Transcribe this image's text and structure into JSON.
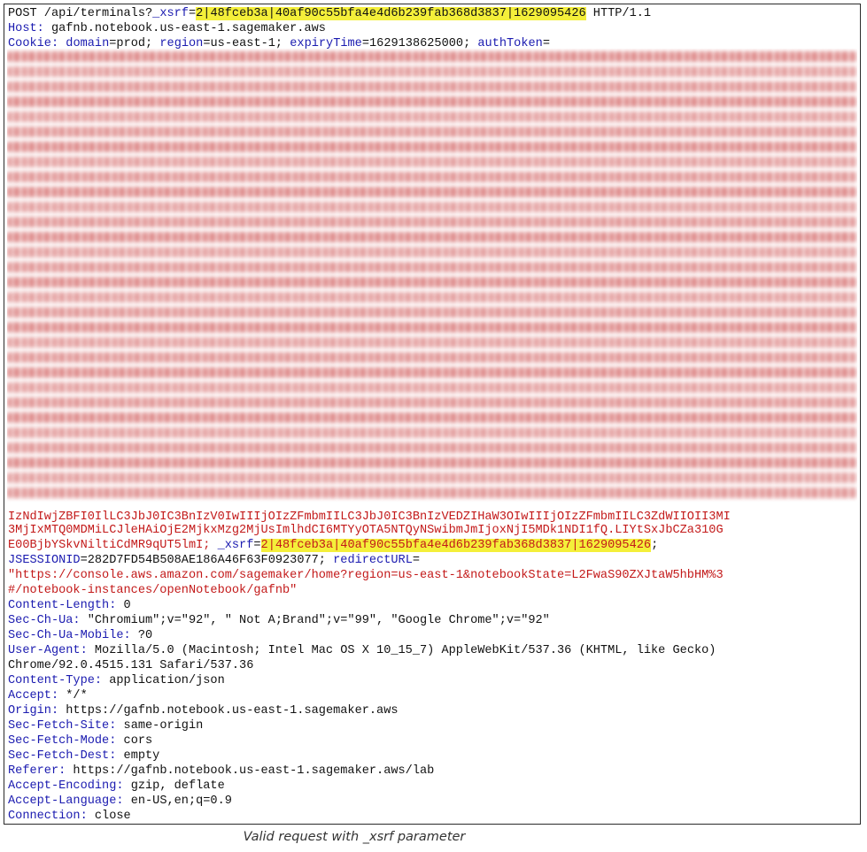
{
  "request": {
    "line1": {
      "prefix": "POST /api/terminals?",
      "param_name": "_xsrf",
      "eq": "=",
      "value": "2|48fceb3a|40af90c55bfa4e4d6b239fab368d3837|1629095426",
      "suffix": " HTTP/1.1"
    },
    "host": {
      "name": "Host:",
      "value": " gafnb.notebook.us-east-1.sagemaker.aws"
    },
    "cookie": {
      "name": "Cookie:",
      "domain_key": "domain",
      "domain_val": "prod",
      "region_key": "region",
      "region_val": "us-east-1",
      "expiry_key": "expiryTime",
      "expiry_val": "1629138625000",
      "auth_key": "authToken"
    },
    "cookie_tail": {
      "line_partial": "IzNdIwjZBFI0IlLC3JbJ0IC3BnIzV0IwIIIjOIzZFmbmIILC3JbJ0IC3BnIzVEDZIHaW3OIwIIIjOIzZFmbmIILC3ZdWIIOII3MI",
      "line_a": "3MjIxMTQ0MDMiLCJleHAiOjE2MjkxMzg2MjUsImlhdCI6MTYyOTA5NTQyNSwibmJmIjoxNjI5MDk1NDI1fQ.LIYtSxJbCZa310G",
      "line_b_start": "E00BjbYSkvNiltiCdMR9qUT5lmI; ",
      "xsrf_key": "_xsrf",
      "xsrf_value": "2|48fceb3a|40af90c55bfa4e4d6b239fab368d3837|1629095426",
      "semicolon": ";",
      "jsession_key": "JSESSIONID",
      "jsession_val": "282D7FD54B508AE186A46F63F0923077",
      "redirect_key": "redirectURL",
      "redirect_val_1": "\"https://console.aws.amazon.com/sagemaker/home?region=us-east-1&notebookState=L2FwaS90ZXJtaW5hbHM%3",
      "redirect_val_2": "#/notebook-instances/openNotebook/gafnb\""
    },
    "headers": [
      {
        "name": "Content-Length:",
        "value": " 0"
      },
      {
        "name": "Sec-Ch-Ua:",
        "value": " \"Chromium\";v=\"92\", \" Not A;Brand\";v=\"99\", \"Google Chrome\";v=\"92\""
      },
      {
        "name": "Sec-Ch-Ua-Mobile:",
        "value": " ?0"
      },
      {
        "name": "User-Agent:",
        "value": " Mozilla/5.0 (Macintosh; Intel Mac OS X 10_15_7) AppleWebKit/537.36 (KHTML, like Gecko)"
      },
      {
        "name": "",
        "value": "Chrome/92.0.4515.131 Safari/537.36"
      },
      {
        "name": "Content-Type:",
        "value": " application/json"
      },
      {
        "name": "Accept:",
        "value": " */*"
      },
      {
        "name": "Origin:",
        "value": " https://gafnb.notebook.us-east-1.sagemaker.aws"
      },
      {
        "name": "Sec-Fetch-Site:",
        "value": " same-origin"
      },
      {
        "name": "Sec-Fetch-Mode:",
        "value": " cors"
      },
      {
        "name": "Sec-Fetch-Dest:",
        "value": " empty"
      },
      {
        "name": "Referer:",
        "value": " https://gafnb.notebook.us-east-1.sagemaker.aws/lab"
      },
      {
        "name": "Accept-Encoding:",
        "value": " gzip, deflate"
      },
      {
        "name": "Accept-Language:",
        "value": " en-US,en;q=0.9"
      },
      {
        "name": "Connection:",
        "value": " close"
      }
    ]
  },
  "caption": "Valid request with _xsrf parameter",
  "colors": {
    "header_name": "#1b1bb0",
    "highlight": "#f4ef3a",
    "string": "#c31a1a",
    "redaction": "#d97a7a"
  }
}
